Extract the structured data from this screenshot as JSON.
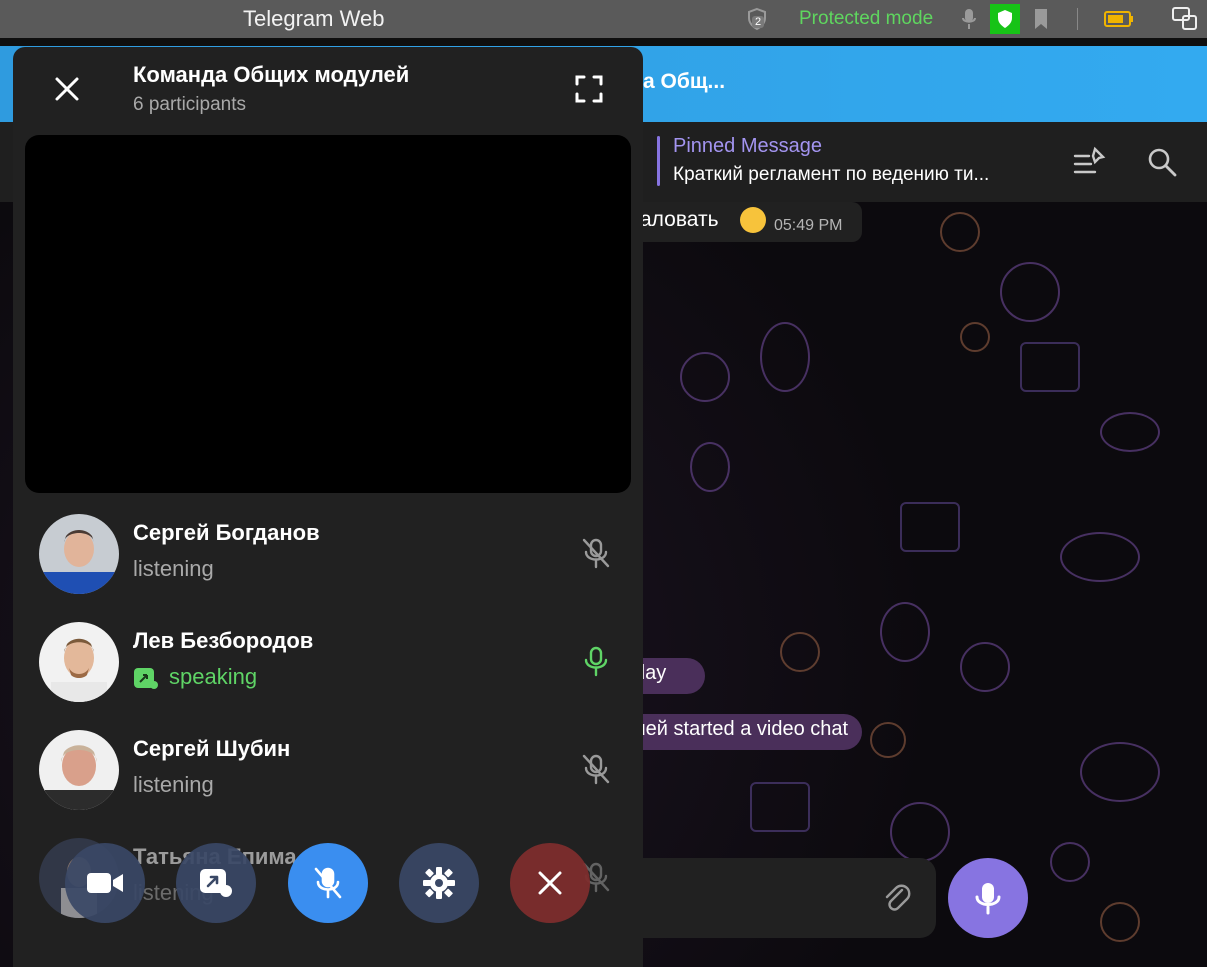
{
  "os": {
    "window_title": "Telegram Web",
    "badge_count": "2",
    "protected_mode": "Protected mode"
  },
  "app": {
    "chat_name_partial": "а Общ...",
    "pinned": {
      "title": "Pinned Message",
      "text": "Краткий регламент по ведению ти..."
    },
    "messages": {
      "msg1_text": "аловать",
      "msg1_time": "05:49 PM",
      "service1": "day",
      "service2": "лей started a video chat"
    }
  },
  "call": {
    "title": "Команда Общих модулей",
    "subtitle": "6 participants",
    "participants": [
      {
        "name": "Сергей Богданов",
        "status": "listening",
        "mic": "muted"
      },
      {
        "name": "Лев Безбородов",
        "status": "speaking",
        "mic": "active"
      },
      {
        "name": "Сергей Шубин",
        "status": "listening",
        "mic": "muted"
      },
      {
        "name": "Татьяна Епима",
        "status": "listening",
        "mic": "muted"
      }
    ],
    "colors": {
      "accent_blue": "#3a8ef0",
      "speaking_green": "#5fd466",
      "leave_red": "#7d2d2d",
      "panel_bg": "#212121"
    }
  }
}
